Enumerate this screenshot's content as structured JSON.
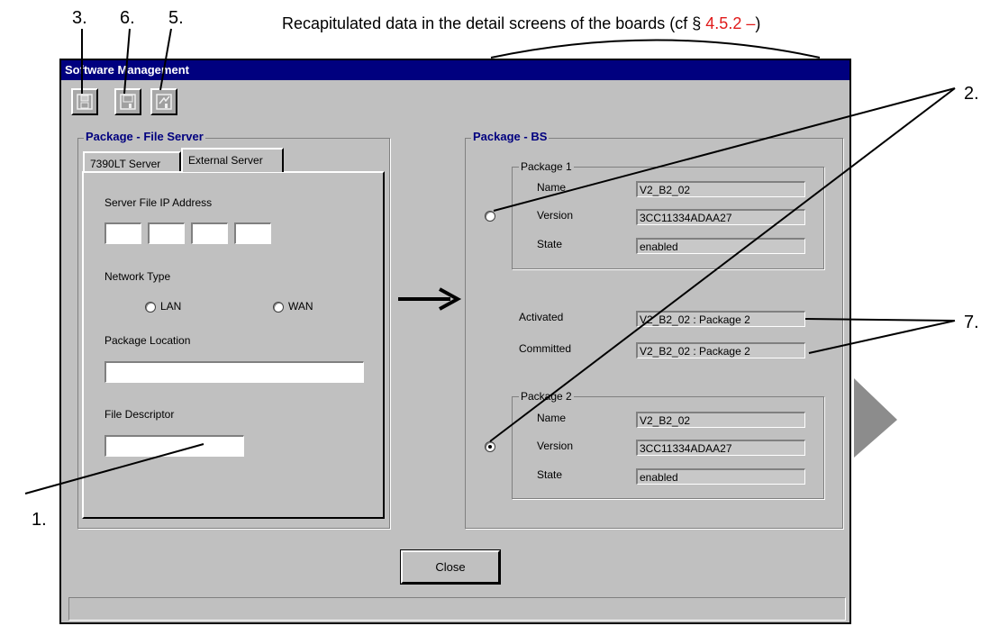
{
  "annotations": {
    "n3": "3.",
    "n6": "6.",
    "n5": "5.",
    "n2": "2.",
    "n7": "7.",
    "n1": "1."
  },
  "caption": {
    "text": "Recapitulated data in the detail screens of the boards (cf § ",
    "ref": "4.5.2 –",
    "end": ")",
    "ref_color": "#e01a1a"
  },
  "window": {
    "title": "Software Management"
  },
  "toolbar": {
    "icons": [
      "floppy-icon",
      "floppy-icon",
      "floppy-icon"
    ]
  },
  "file_server": {
    "title": "Package - File Server",
    "tabs": [
      "7390LT Server",
      "External Server"
    ],
    "active_tab": "External Server",
    "ip_label": "Server File IP Address",
    "ip_octets": [
      "",
      "",
      "",
      ""
    ],
    "network_type_label": "Network Type",
    "network_options": [
      "LAN",
      "WAN"
    ],
    "package_location_label": "Package Location",
    "package_location_value": "",
    "file_descriptor_label": "File Descriptor",
    "file_descriptor_value": ""
  },
  "package_bs": {
    "title": "Package - BS",
    "package1": {
      "title": "Package 1",
      "name_label": "Name",
      "name": "V2_B2_02",
      "version_label": "Version",
      "version": "3CC11334ADAA27",
      "state_label": "State",
      "state": "enabled",
      "selected": false
    },
    "activated_label": "Activated",
    "activated": "V2_B2_02 : Package 2",
    "committed_label": "Committed",
    "committed": "V2_B2_02 : Package 2",
    "package2": {
      "title": "Package 2",
      "name_label": "Name",
      "name": "V2_B2_02",
      "version_label": "Version",
      "version": "3CC11334ADAA27",
      "state_label": "State",
      "state": "enabled",
      "selected": true
    }
  },
  "close_button": "Close",
  "colors": {
    "title_bar": "#00007f",
    "group_title": "#00007f",
    "window_bg": "#c0c0c0"
  }
}
